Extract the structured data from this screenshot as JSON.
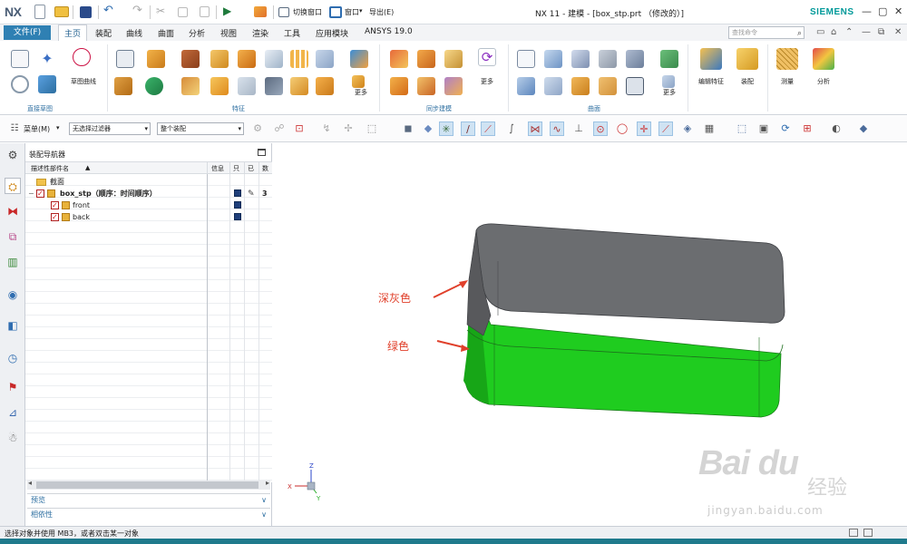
{
  "app": {
    "logo": "NX",
    "title": "NX 11 - 建模 - [box_stp.prt （修改的）]",
    "brand": "SIEMENS",
    "quick_access": {
      "switch_window": "切换窗口",
      "window": "窗口",
      "import_export": "导出(E)"
    }
  },
  "menu": {
    "file": "文件(F)",
    "tabs": [
      "主页",
      "装配",
      "曲线",
      "曲面",
      "分析",
      "视图",
      "渲染",
      "工具",
      "应用模块",
      "ANSYS 19.0"
    ],
    "search_placeholder": "查找命令"
  },
  "ribbon": {
    "sketch_curve_label": "草图曲线",
    "groups": [
      "直接草图",
      "特征",
      "同步建模",
      "曲面"
    ],
    "more": "更多",
    "big_buttons": [
      "编辑特征",
      "装配",
      "测量",
      "分析"
    ]
  },
  "toolbar": {
    "menu_label": "菜单(M)",
    "filter": "无选择过滤器",
    "assembly_scope": "整个装配"
  },
  "navigator": {
    "title": "装配导航器",
    "columns": [
      "描述性部件名",
      "信息",
      "只",
      "已",
      "数"
    ],
    "rows": [
      {
        "name": "截面",
        "level": 1,
        "kind": "folder"
      },
      {
        "name": "box_stp（顺序：时间顺序）",
        "level": 1,
        "kind": "assembly",
        "count": "3"
      },
      {
        "name": "front",
        "level": 2,
        "kind": "part"
      },
      {
        "name": "back",
        "level": 2,
        "kind": "part"
      }
    ],
    "preview": "预览",
    "dependency": "相依性"
  },
  "viewport": {
    "annotations": [
      {
        "label": "深灰色",
        "color": "#e0402b"
      },
      {
        "label": "绿色",
        "color": "#e0402b"
      }
    ],
    "model_colors": {
      "top": "#6b6d70",
      "bottom": "#1fc41f"
    },
    "triad": {
      "z": "Z",
      "x": "X",
      "y": "Y"
    }
  },
  "status": {
    "text": "选择对象并使用 MB3，或者双击某一对象"
  },
  "watermark": {
    "brand": "Bai du",
    "cn": "经验",
    "url": "jingyan.baidu.com"
  },
  "colors": {
    "accent": "#2f80b3",
    "brand": "#009999",
    "bottom_bar": "#1f7a8c"
  }
}
